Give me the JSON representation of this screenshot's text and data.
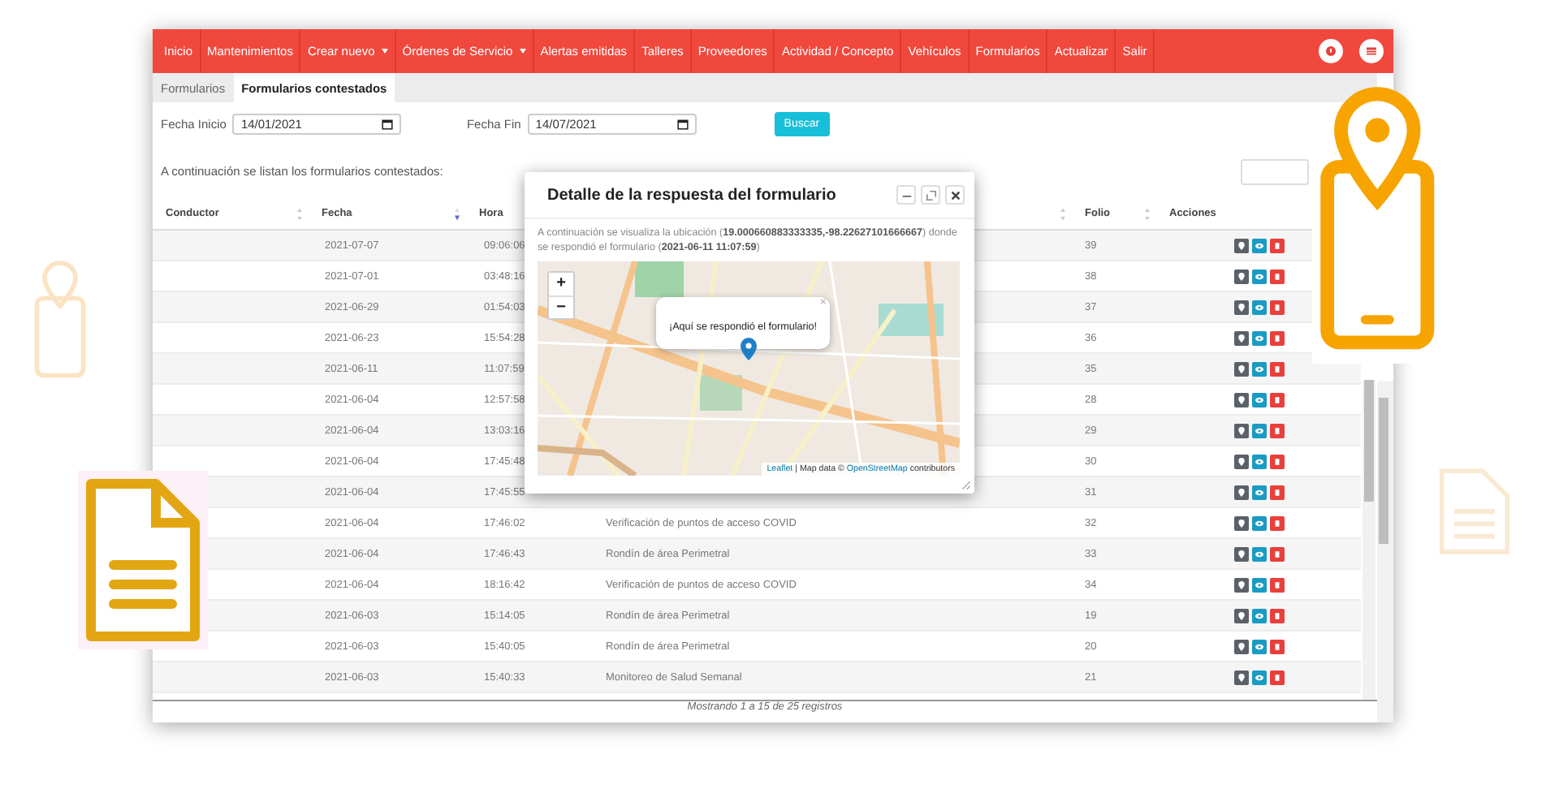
{
  "navbar": {
    "items": [
      {
        "label": "Inicio",
        "dropdown": false
      },
      {
        "label": "Mantenimientos",
        "dropdown": false
      },
      {
        "label": "Crear nuevo",
        "dropdown": true
      },
      {
        "label": "Órdenes de Servicio",
        "dropdown": true
      },
      {
        "label": "Alertas emitidas",
        "dropdown": false
      },
      {
        "label": "Talleres",
        "dropdown": false
      },
      {
        "label": "Proveedores",
        "dropdown": false
      },
      {
        "label": "Actividad / Concepto",
        "dropdown": false
      },
      {
        "label": "Vehículos",
        "dropdown": false
      },
      {
        "label": "Formularios",
        "dropdown": false
      },
      {
        "label": "Actualizar",
        "dropdown": false
      },
      {
        "label": "Salir",
        "dropdown": false
      }
    ]
  },
  "tabs": [
    {
      "label": "Formularios",
      "selected": false
    },
    {
      "label": "Formularios contestados",
      "selected": true
    }
  ],
  "filters": {
    "start_label": "Fecha Inicio",
    "start_value": "14/01/2021",
    "end_label": "Fecha Fin",
    "end_value": "14/07/2021",
    "button": "Buscar"
  },
  "intro": "A continuación se listan los formularios contestados:",
  "table": {
    "columns": [
      {
        "label": "Conductor",
        "sortable": true,
        "sorted_descending": false
      },
      {
        "label": "Fecha",
        "sortable": true,
        "sorted_descending": true
      },
      {
        "label": "Hora"
      },
      {
        "sortable": true,
        "sorted_descending": false
      },
      {
        "label": "Folio",
        "sortable": true,
        "sorted_descending": false
      },
      {
        "label": "Acciones"
      }
    ],
    "rows": [
      {
        "fecha": "2021-07-07",
        "hora": "09:06:06",
        "folio": "39"
      },
      {
        "fecha": "2021-07-01",
        "hora": "03:48:16",
        "folio": "38"
      },
      {
        "fecha": "2021-06-29",
        "hora": "01:54:03",
        "folio": "37"
      },
      {
        "fecha": "2021-06-23",
        "hora": "15:54:28",
        "folio": "36"
      },
      {
        "fecha": "2021-06-11",
        "hora": "11:07:59",
        "folio": "35"
      },
      {
        "fecha": "2021-06-04",
        "hora": "12:57:58",
        "folio": "28"
      },
      {
        "fecha": "2021-06-04",
        "hora": "13:03:16",
        "folio": "29"
      },
      {
        "fecha": "2021-06-04",
        "hora": "17:45:48",
        "folio": "30"
      },
      {
        "fecha": "2021-06-04",
        "hora": "17:45:55",
        "folio": "31"
      },
      {
        "fecha": "2021-06-04",
        "hora": "17:46:02",
        "formulario": "Verificación de puntos de acceso COVID",
        "folio": "32"
      },
      {
        "fecha": "2021-06-04",
        "hora": "17:46:43",
        "formulario": "Rondín de área Perimetral",
        "folio": "33"
      },
      {
        "fecha": "2021-06-04",
        "hora": "18:16:42",
        "formulario": "Verificación de puntos de acceso COVID",
        "folio": "34"
      },
      {
        "fecha": "2021-06-03",
        "hora": "15:14:05",
        "formulario": "Rondín de área Perimetral",
        "folio": "19"
      },
      {
        "fecha": "2021-06-03",
        "hora": "15:40:05",
        "formulario": "Rondín de área Perimetral",
        "folio": "20"
      },
      {
        "fecha": "2021-06-03",
        "hora": "15:40:33",
        "formulario": "Monitoreo de Salud Semanal",
        "folio": "21"
      }
    ],
    "footer": "Mostrando 1 a 15 de 25 registros"
  },
  "modal": {
    "title": "Detalle de la respuesta del formulario",
    "description": "A continuación se visualiza la ubicación (**19.000660883333335,-98.22627101666667**) donde se respondió el formulario (**2021-06-11 11:07:59**)",
    "zoom_in": "+",
    "zoom_out": "−",
    "popup": "¡Aquí se respondió el formulario!",
    "popup_close": "×",
    "attribution": [
      {
        "text": "Leaflet",
        "link": true
      },
      {
        "text": "| Map data ©",
        "link": false
      },
      {
        "text": "OpenStreetMap",
        "link": true
      },
      {
        "text": "contributors",
        "link": false
      }
    ]
  }
}
